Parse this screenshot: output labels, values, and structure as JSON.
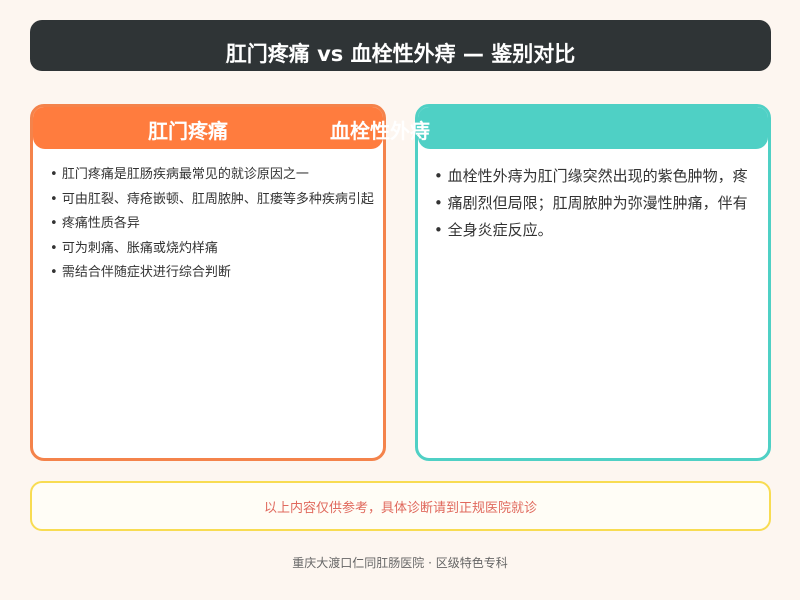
{
  "title": "肛门疼痛 vs 血栓性外痔 — 鉴别对比",
  "left_card": {
    "heading": "肛门疼痛",
    "items": [
      "肛门疼痛是肛肠疾病最常见的就诊原因之一",
      "可由肛裂、痔疮嵌顿、肛周脓肿、肛瘘等多种疾病引起",
      "疼痛性质各异",
      "可为刺痛、胀痛或烧灼样痛",
      "需结合伴随症状进行综合判断"
    ]
  },
  "right_card": {
    "heading": "血栓性外痔",
    "items": [
      "血栓性外痔为肛门缘突然出现的紫色肿物，疼",
      "痛剧烈但局限；肛周脓肿为弥漫性肿痛，伴有",
      "全身炎症反应。"
    ]
  },
  "notice": "以上内容仅供参考，具体诊断请到正规医院就诊",
  "footer": "重庆大渡口仁同肛肠医院 · 区级特色专科",
  "colors": {
    "title_bg": "#2f3436",
    "left_accent": "#ff7c3e",
    "right_accent": "#4fd0c5",
    "notice_border": "#f8dc52",
    "notice_text": "#e0695d"
  }
}
